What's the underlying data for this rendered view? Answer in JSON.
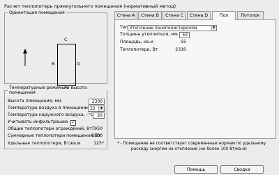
{
  "window": {
    "title": "Расчет теплопотерь прямоугольного помещения (нормативный метод)"
  },
  "orientation": {
    "legend": "Ориентация помещения",
    "walls": {
      "a": "A",
      "b": "B",
      "c": "C",
      "d": "D"
    },
    "north_arrow_icon": "arrow-up-icon"
  },
  "temps": {
    "legend": "Температурные режимы и высота помещения",
    "height_label": "Высота помещения, мм",
    "height_value": "2300",
    "indoor_label": "Температура воздуха в помещении, °С",
    "indoor_value": "22",
    "outdoor_label": "Температура наружного воздуха, –°С",
    "outdoor_value": "20",
    "infiltration_label": "Учитывать инфильтрацию",
    "infiltration_checked": true,
    "walls_loss_label": "Общие теплопотери ограждений, Вт",
    "walls_loss_value": "7950",
    "total_loss_label": "Суммарные теплопотери помещения, Вт",
    "total_loss_value": "6900",
    "specific_loss_label": "Удельные теплопотери, Вт/кв.м",
    "specific_loss_value": "125*"
  },
  "tabs": [
    {
      "label": "Стена А",
      "active": false
    },
    {
      "label": "Стена B",
      "active": false
    },
    {
      "label": "Стена C",
      "active": false
    },
    {
      "label": "Стена D",
      "active": false
    },
    {
      "label": "Пол",
      "active": true
    },
    {
      "label": "Потолок",
      "active": false
    }
  ],
  "floor_tab": {
    "type_label": "Тип",
    "type_value": "Утепление пенополистиролом",
    "thickness_label": "Толщина утеплителя, мм",
    "thickness_value": "50",
    "area_label": "Площадь, кв.м",
    "area_value": "55",
    "loss_label": "Теплопотери, Вт",
    "loss_value": "2310"
  },
  "footnote": {
    "line1": "* - Помещение не соответствует современным нормам по удельному",
    "line2": "расходу энергии на отопление (не более 100 Вт/кв.м)"
  },
  "buttons": {
    "help": "Помощь",
    "summary": "Сводка"
  }
}
